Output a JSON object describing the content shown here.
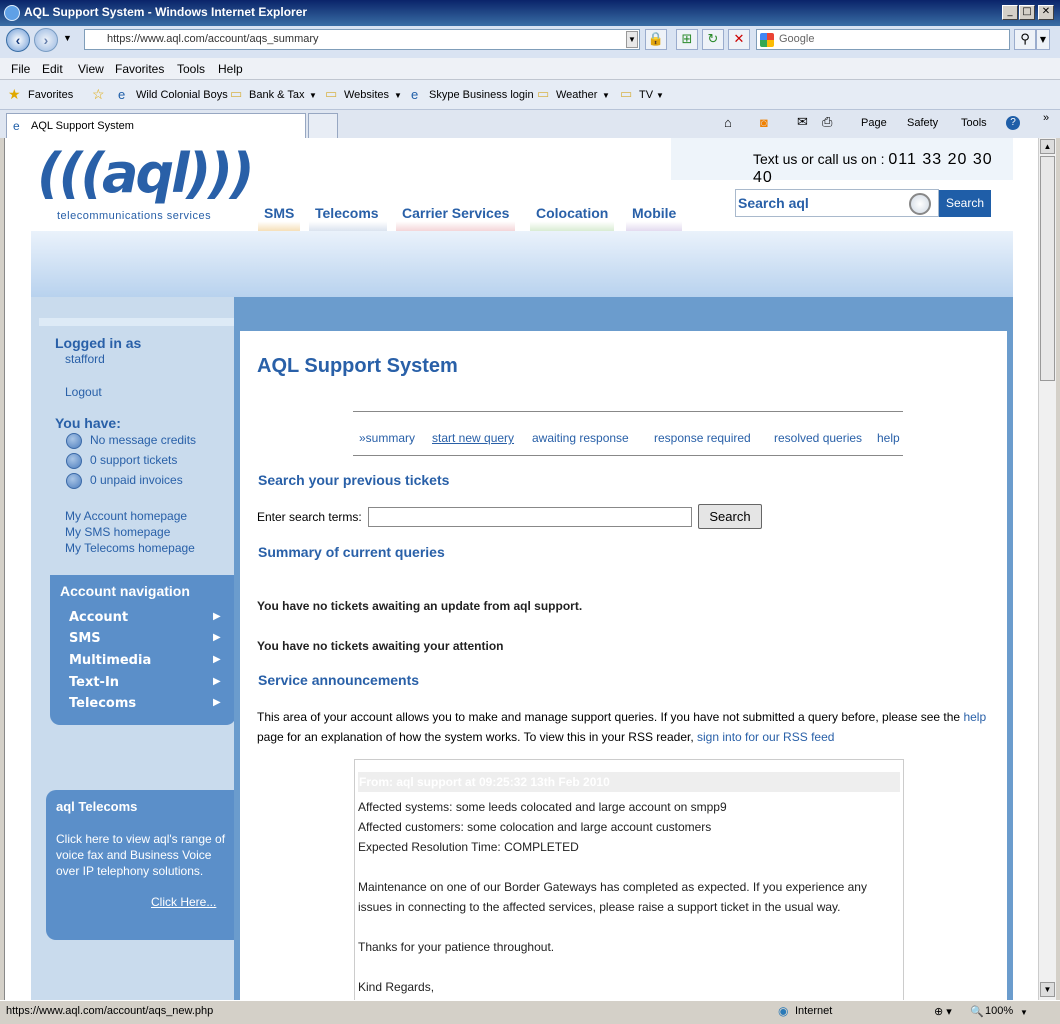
{
  "window": {
    "title": "AQL Support System - Windows Internet Explorer",
    "min": "_",
    "max": "□",
    "close": "✕"
  },
  "address": {
    "url": "https://www.aql.com/account/aqs_summary",
    "search_placeholder": "Google"
  },
  "menu": [
    "File",
    "Edit",
    "View",
    "Favorites",
    "Tools",
    "Help"
  ],
  "favorites": {
    "label": "Favorites",
    "items": [
      "Wild Colonial Boys",
      "Bank & Tax",
      "Websites",
      "Skype Business login",
      "Weather",
      "TV"
    ]
  },
  "tab": {
    "title": "AQL Support System"
  },
  "commandbar": [
    "Page",
    "Safety",
    "Tools"
  ],
  "header": {
    "logo": "(((aql)))",
    "logo_sub": "telecommunications services",
    "contact_prefix": "Text us or call us on :",
    "contact_number": "011 33 20 30 40",
    "nav": [
      "SMS",
      "Telecoms",
      "Carrier Services",
      "Colocation",
      "Mobile"
    ],
    "nav_colors": [
      "#f6dfb8",
      "#dbe3ef",
      "#f4d5d8",
      "#d9ecd3",
      "#e3daef"
    ],
    "search_placeholder": "Search aql",
    "search_button": "Search"
  },
  "sidebar": {
    "logged_in_label": "Logged in as",
    "username": "stafford",
    "logout": "Logout",
    "you_have": "You have:",
    "items": [
      "No message credits",
      "0 support tickets",
      "0 unpaid invoices"
    ],
    "links": [
      "My Account homepage",
      "My SMS homepage",
      "My Telecoms homepage"
    ],
    "account_nav": {
      "title": "Account navigation",
      "items": [
        "Account",
        "SMS",
        "Multimedia",
        "Text-In",
        "Telecoms"
      ]
    },
    "telecoms_box": {
      "title": "aql Telecoms",
      "text": "Click here to view aql's range of voice fax and Business Voice over IP telephony solutions.",
      "link": "Click Here..."
    }
  },
  "main": {
    "title": "AQL Support System",
    "subnav": [
      "»summary",
      "start new query",
      "awaiting response",
      "response required",
      "resolved queries",
      "help"
    ],
    "search_heading": "Search your previous tickets",
    "search_label": "Enter search terms:",
    "search_button": "Search",
    "summary_heading": "Summary of current queries",
    "no_update": "You have no tickets awaiting an update from aql support.",
    "no_attention": "You have no tickets awaiting your attention",
    "service_heading": "Service announcements",
    "intro_1": "This area of your account allows you to make and manage support queries. If you have not submitted a query before, please see the",
    "intro_help": "help",
    "intro_2": "page for an explanation of how the system works. To view this in your RSS reader,",
    "intro_rss": "sign into for our RSS feed",
    "announcement": {
      "header": "From: aql support at 09:25:32 13th Feb 2010",
      "lines": [
        "Affected systems: some leeds colocated and large account on smpp9",
        "Affected customers: some colocation and large account customers",
        "Expected Resolution Time: COMPLETED",
        "Maintenance on one of our Border Gateways has completed as expected. If you experience any",
        "issues in connecting to the affected services, please raise a support ticket in the usual way.",
        "Thanks for your patience throughout.",
        "Kind Regards,"
      ]
    }
  },
  "status": {
    "url": "https://www.aql.com/account/aqs_new.php",
    "zone": "Internet",
    "zoom": "100%"
  }
}
